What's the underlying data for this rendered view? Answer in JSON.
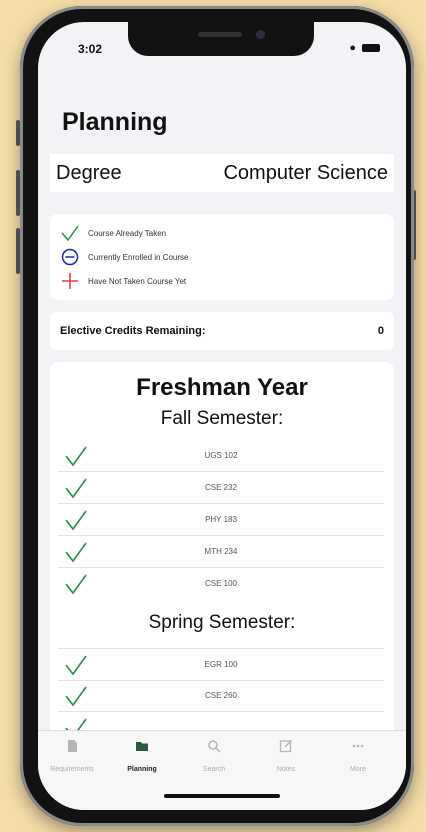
{
  "status": {
    "time": "3:02"
  },
  "page": {
    "title": "Planning"
  },
  "degree": {
    "label": "Degree",
    "value": "Computer Science"
  },
  "legend": {
    "taken": "Course Already Taken",
    "enrolled": "Currently Enrolled in Course",
    "not_taken": "Have Not Taken Course Yet"
  },
  "elective": {
    "label": "Elective Credits Remaining:",
    "value": "0"
  },
  "plan": {
    "year": "Freshman Year",
    "fall": {
      "title": "Fall Semester:",
      "courses": [
        "UGS 102",
        "CSE 232",
        "PHY 183",
        "MTH 234",
        "CSE 100"
      ]
    },
    "spring": {
      "title": "Spring Semester:",
      "courses": [
        "EGR 100",
        "CSE 260"
      ]
    }
  },
  "tabs": [
    {
      "label": "Requirements",
      "icon": "document-icon"
    },
    {
      "label": "Planning",
      "icon": "folder-icon"
    },
    {
      "label": "Search",
      "icon": "search-icon"
    },
    {
      "label": "Notes",
      "icon": "note-icon"
    },
    {
      "label": "More",
      "icon": "more-icon"
    }
  ],
  "colors": {
    "check": "#2e8b4e",
    "enrolled": "#1a2a9c",
    "not_taken": "#e02020",
    "active_tab": "#2b5a3c"
  }
}
